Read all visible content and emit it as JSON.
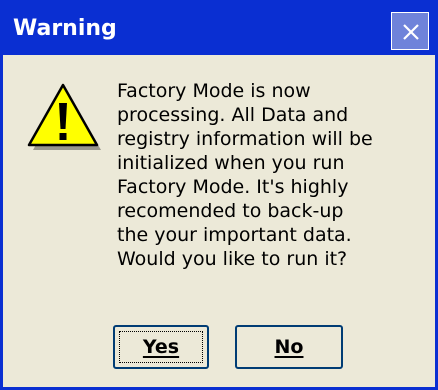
{
  "dialog": {
    "title": "Warning",
    "close_icon": "close-icon",
    "status_icon": "warning-icon",
    "message_lines": [
      "Factory Mode is now",
      "processing. All Data and",
      "registry information will be",
      "initialized when you run",
      "Factory Mode. It's highly",
      "recomended to back-up",
      "the your important data.",
      "Would you like to run it?"
    ],
    "buttons": {
      "yes_label": "Yes",
      "no_label": "No"
    }
  },
  "colors": {
    "titlebar": "#0a2fd2",
    "dialog_background": "#ece9d8",
    "warning_fill": "#ffff00"
  }
}
